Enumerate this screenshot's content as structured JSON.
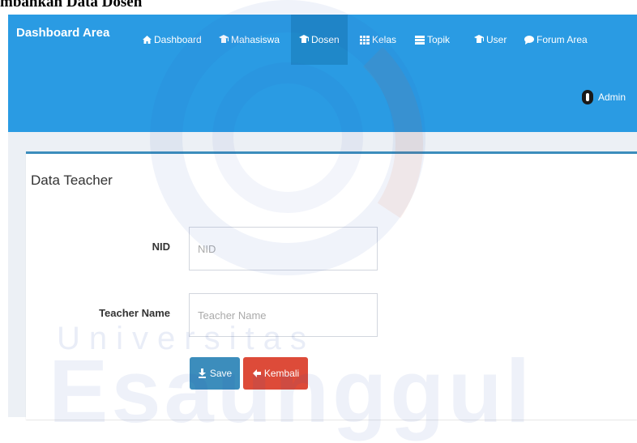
{
  "document": {
    "title": "mbahkan Data Dosen"
  },
  "navbar": {
    "brand": "Dashboard Area",
    "items": [
      {
        "label": "Dashboard",
        "icon": "home-icon",
        "active": false
      },
      {
        "label": "Mahasiswa",
        "icon": "graduation-icon",
        "active": false
      },
      {
        "label": "Dosen",
        "icon": "graduation-icon",
        "active": true
      },
      {
        "label": "Kelas",
        "icon": "grid-icon",
        "active": false
      },
      {
        "label": "Topik",
        "icon": "list-icon",
        "active": false
      },
      {
        "label": "User",
        "icon": "graduation-icon",
        "active": false
      },
      {
        "label": "Forum Area",
        "icon": "comment-icon",
        "active": false
      }
    ],
    "user": {
      "name": "Admin",
      "icon": "user-icon"
    }
  },
  "box": {
    "title": "Data Teacher"
  },
  "form": {
    "nid": {
      "label": "NID",
      "placeholder": "NID",
      "value": ""
    },
    "teacher_name": {
      "label": "Teacher Name",
      "placeholder": "Teacher Name",
      "value": ""
    },
    "save_label": "Save",
    "back_label": "Kembali"
  },
  "watermark": {
    "line1": "Universitas",
    "line2": "Esaunggul"
  },
  "colors": {
    "navbar": "#2a9be3",
    "navbar_active": "#1f88c9",
    "box_border": "#3c8dbc",
    "save_button": "#3c8dbc",
    "back_button": "#dd4b39",
    "content_bg": "#ecf0f5"
  }
}
